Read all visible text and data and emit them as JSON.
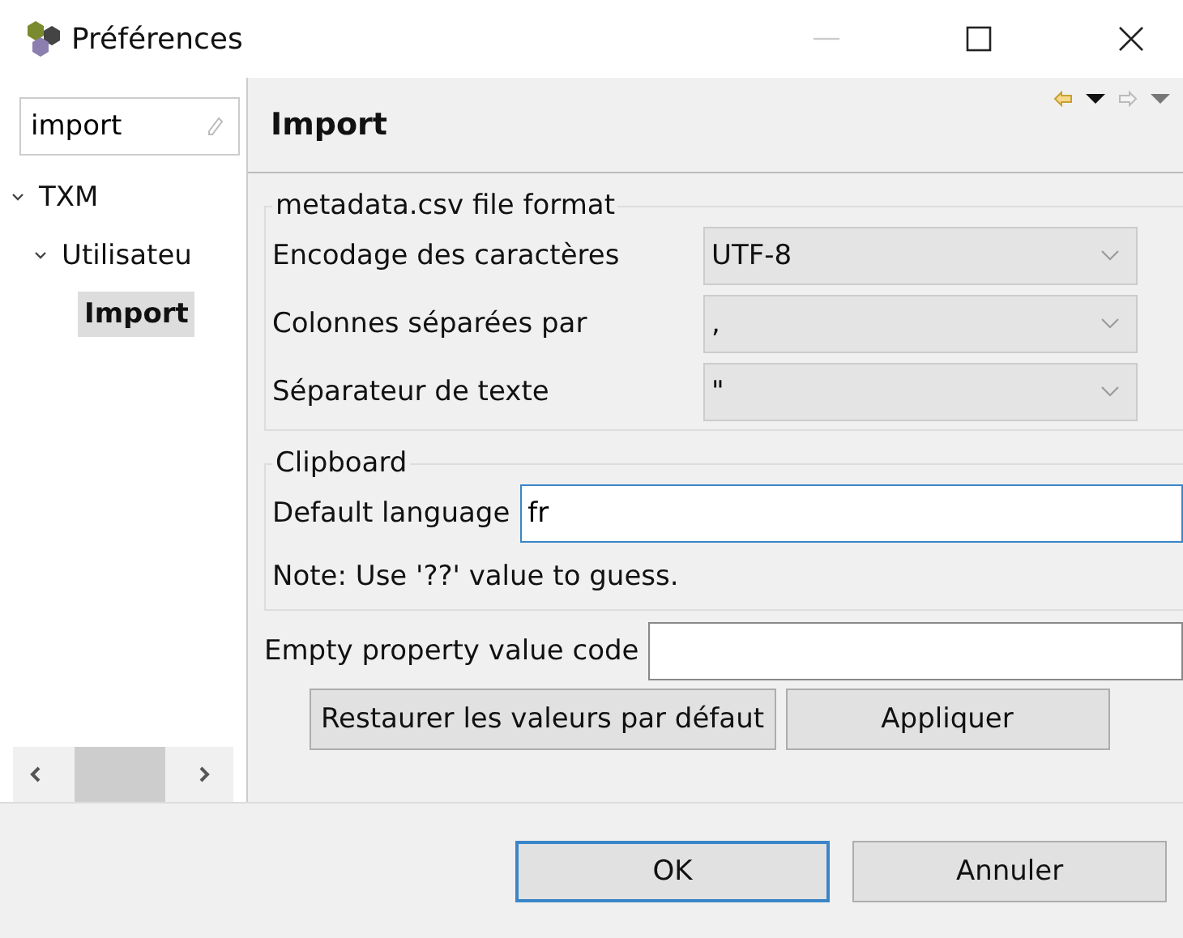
{
  "window": {
    "title": "Préférences"
  },
  "sidebar": {
    "search": {
      "value": "import"
    },
    "tree": [
      {
        "label": "TXM",
        "expanded": true,
        "selected": false,
        "children": [
          {
            "label": "Utilisateu",
            "expanded": true,
            "selected": false,
            "children": [
              {
                "label": "Import",
                "selected": true
              }
            ]
          }
        ]
      }
    ]
  },
  "page": {
    "title": "Import",
    "groups": [
      {
        "title": "metadata.csv file format",
        "rows": [
          {
            "kind": "combo",
            "label": "Encodage des caractères",
            "value": "UTF-8"
          },
          {
            "kind": "combo",
            "label": "Colonnes séparées par",
            "value": ","
          },
          {
            "kind": "combo",
            "label": "Séparateur de texte",
            "value": "\""
          }
        ]
      },
      {
        "title": "Clipboard",
        "rows": [
          {
            "kind": "text",
            "label": "Default language",
            "value": "fr",
            "focused": true
          },
          {
            "kind": "note",
            "label": "Note: Use '??' value to guess."
          }
        ]
      }
    ],
    "fields": [
      {
        "label": "Empty property value code",
        "focused": false
      }
    ],
    "buttons": [
      "Restaurer les valeurs par défaut",
      "Appliquer"
    ]
  },
  "dialog_buttons": [
    {
      "label": "OK",
      "default": true
    },
    {
      "label": "Annuler",
      "default": false
    }
  ]
}
